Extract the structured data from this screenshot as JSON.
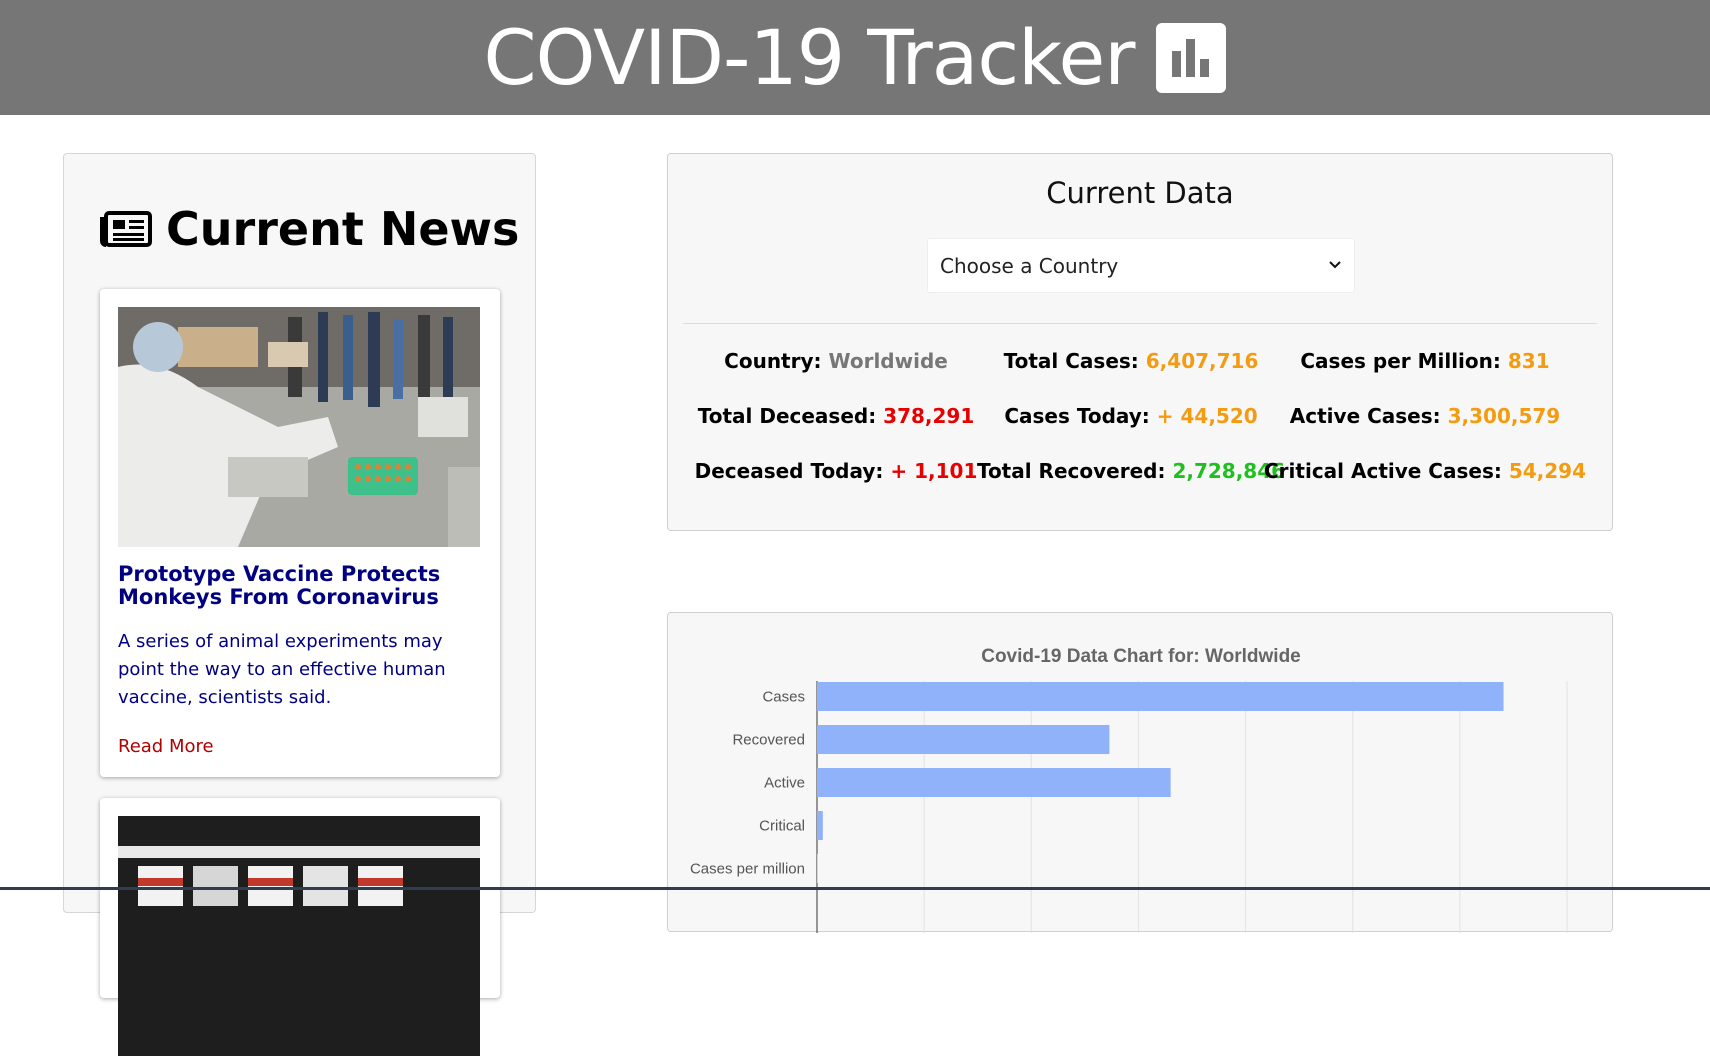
{
  "header": {
    "title": "COVID-19 Tracker",
    "logo_icon": "bar-chart-icon",
    "background": "#767676"
  },
  "news": {
    "heading": "Current News",
    "heading_icon": "newspaper-icon",
    "articles": [
      {
        "title": "Prototype Vaccine Protects Monkeys From Coronavirus",
        "description": "A series of animal experiments may point the way to an effective human vaccine, scientists said.",
        "link_label": "Read More",
        "image": "lab-researcher-photo"
      },
      {
        "image": "vials-rack-photo"
      }
    ]
  },
  "current_data": {
    "heading": "Current Data",
    "select": {
      "selected": "Choose a Country"
    },
    "stats": [
      {
        "label": "Country:",
        "value": "Worldwide",
        "color": "#777777"
      },
      {
        "label": "Total Cases:",
        "value": "6,407,716",
        "color": "#f39c12"
      },
      {
        "label": "Cases per Million:",
        "value": "831",
        "color": "#f39c12"
      },
      {
        "label": "Total Deceased:",
        "value": "378,291",
        "color": "#e60000"
      },
      {
        "label": "Cases Today:",
        "value": "+ 44,520",
        "color": "#f39c12"
      },
      {
        "label": "Active Cases:",
        "value": "3,300,579",
        "color": "#f39c12"
      },
      {
        "label": "Deceased Today:",
        "value": "+ 1,101",
        "color": "#e60000"
      },
      {
        "label": "Total Recovered:",
        "value": "2,728,846",
        "color": "#1fbf1f"
      },
      {
        "label": "Critical Active Cases:",
        "value": "54,294",
        "color": "#f39c12"
      }
    ]
  },
  "chart_data": {
    "type": "bar",
    "orientation": "horizontal",
    "title": "Covid-19 Data Chart for: Worldwide",
    "categories": [
      "Cases",
      "Recovered",
      "Active",
      "Critical",
      "Cases per million"
    ],
    "values": [
      6407716,
      2728846,
      3300579,
      54294,
      831
    ],
    "xlim": [
      0,
      7000000
    ],
    "grid": true,
    "bar_color": "#8fb2fb"
  }
}
